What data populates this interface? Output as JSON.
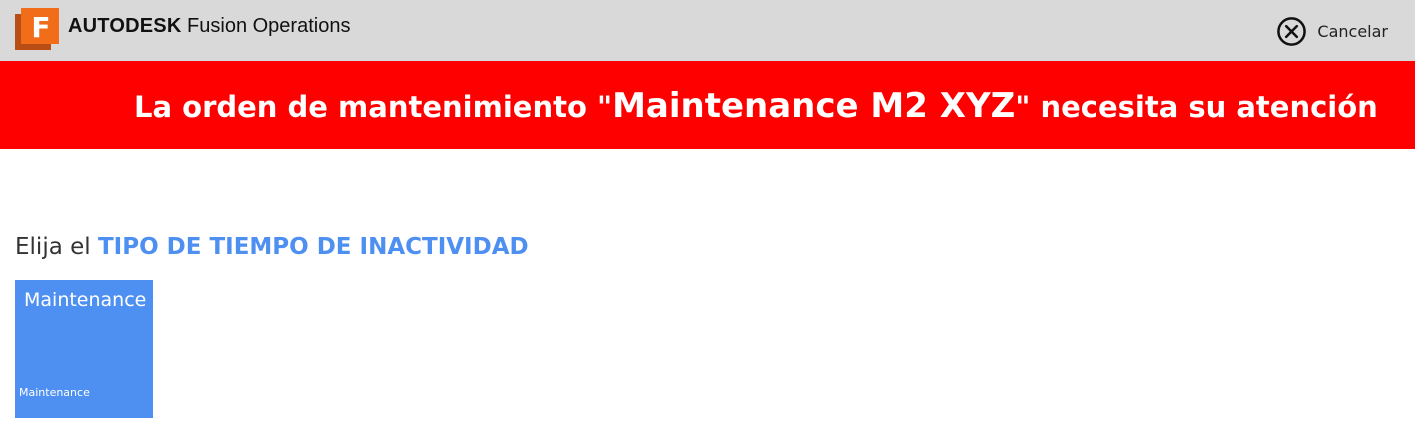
{
  "header": {
    "brand": "AUTODESK",
    "product": "Fusion Operations",
    "logo_letter": "F",
    "logo_colors": {
      "front": "#f26d1a",
      "back": "#c4501a"
    },
    "background": "#d9d9d9",
    "cancel_label": "Cancelar",
    "cancel_icon": "close-circle-icon"
  },
  "alert": {
    "background": "#ff0000",
    "prefix": "La orden de mantenimiento \"",
    "emphasis": "Maintenance M2 XYZ",
    "suffix": "\" necesita su atención"
  },
  "prompt": {
    "prefix": "Elija el ",
    "highlight": "TIPO DE TIEMPO DE INACTIVIDAD",
    "highlight_color": "#4e8ff2"
  },
  "downtime_types": [
    {
      "title": "Maintenance",
      "subtitle": "Maintenance",
      "color": "#4e8ff2"
    }
  ]
}
